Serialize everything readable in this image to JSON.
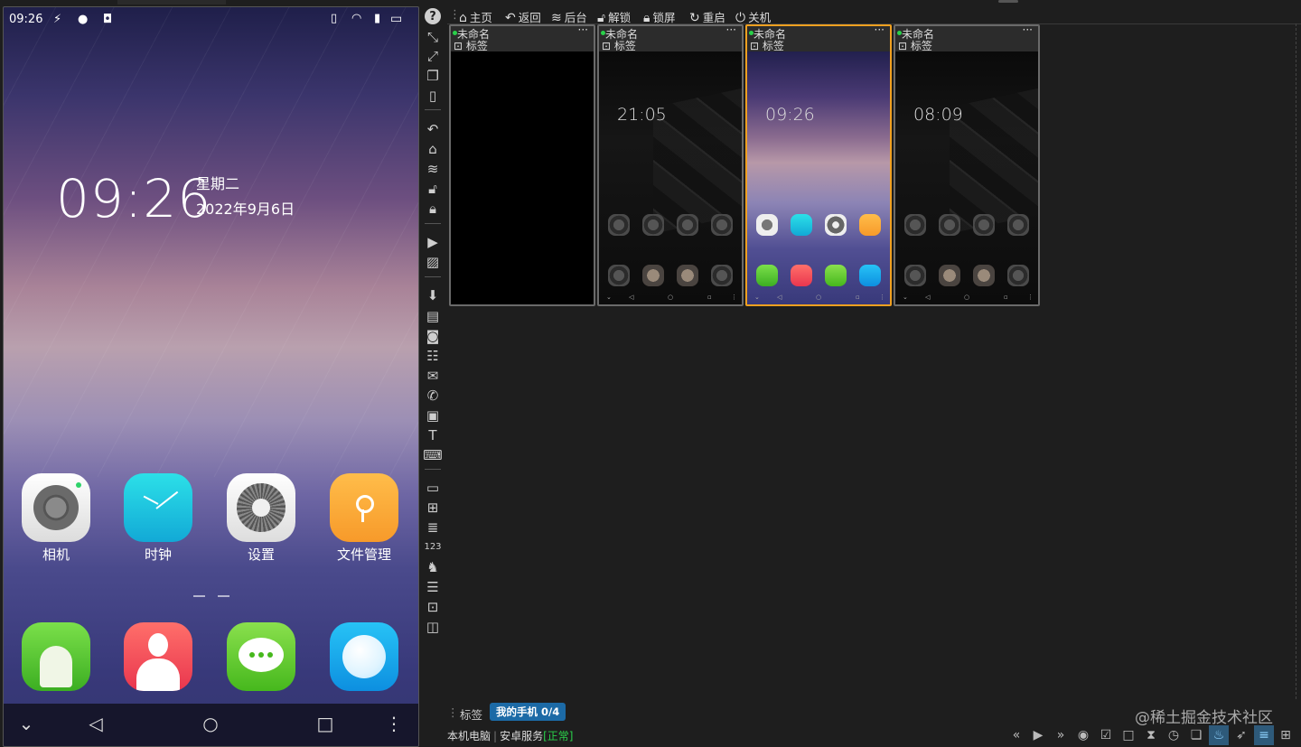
{
  "phone": {
    "status": {
      "time": "09:26",
      "left_icons": [
        "usb-icon",
        "android-icon",
        "app-badge-icon"
      ],
      "right_icons": [
        "vibrate-icon",
        "wifi-icon",
        "sim-alert-icon",
        "battery-icon"
      ]
    },
    "lock_time": "09:26",
    "weekday": "星期二",
    "date": "2022年9月6日",
    "apps": [
      {
        "label": "相机",
        "icon": "camera-icon"
      },
      {
        "label": "时钟",
        "icon": "clock-icon"
      },
      {
        "label": "设置",
        "icon": "settings-icon"
      },
      {
        "label": "文件管理",
        "icon": "file-manager-icon"
      }
    ],
    "dock": [
      {
        "icon": "phone-icon"
      },
      {
        "icon": "contacts-icon"
      },
      {
        "icon": "messages-icon"
      },
      {
        "icon": "browser-icon"
      }
    ],
    "nav": {
      "down": "⌄",
      "back": "◁",
      "home": "○",
      "recent": "□",
      "more": "⋮"
    }
  },
  "toolbar_top": {
    "items": [
      {
        "label": "主页",
        "icon": "home-icon"
      },
      {
        "label": "返回",
        "icon": "back-icon"
      },
      {
        "label": "后台",
        "icon": "layers-icon"
      },
      {
        "label": "解锁",
        "icon": "unlock-icon"
      },
      {
        "label": "锁屏",
        "icon": "lock-icon"
      },
      {
        "label": "重启",
        "icon": "restart-icon"
      },
      {
        "label": "关机",
        "icon": "power-icon"
      }
    ]
  },
  "devices": [
    {
      "name": "未命名",
      "tag": "标签",
      "more": "···",
      "screen": "black"
    },
    {
      "name": "未命名",
      "tag": "标签",
      "more": "···",
      "screen": "dark",
      "time": "21:05"
    },
    {
      "name": "未命名",
      "tag": "标签",
      "more": "···",
      "screen": "purple",
      "time": "09:26",
      "selected": true
    },
    {
      "name": "未命名",
      "tag": "标签",
      "more": "···",
      "screen": "dark",
      "time": "08:09"
    }
  ],
  "bottom": {
    "tags_label": "标签",
    "group_pill": "我的手机  0/4",
    "local_pc": "本机电脑",
    "android_service": "安卓服务",
    "service_status": "[正常]",
    "watermark": "@稀土掘金技术社区"
  },
  "colors": {
    "accent": "#1c6aa6",
    "selected_border": "#f0a020",
    "online": "#2ad04a"
  }
}
